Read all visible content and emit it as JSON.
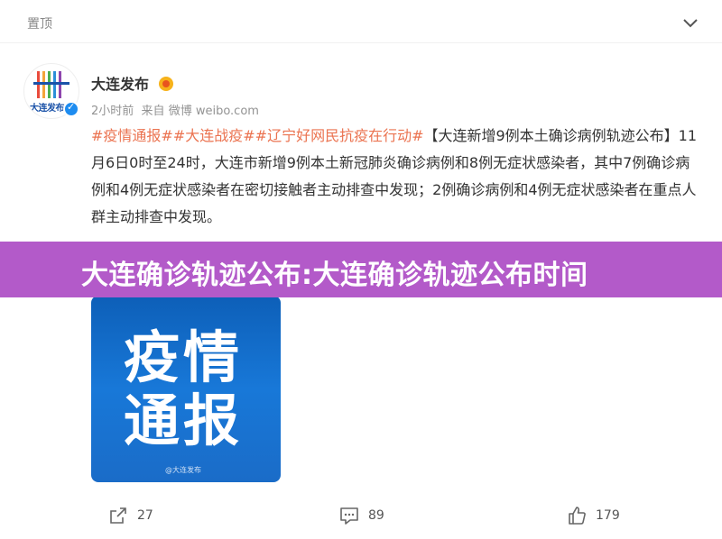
{
  "header": {
    "pinned_label": "置顶"
  },
  "account": {
    "name": "大连发布",
    "avatar_text": "大连发布",
    "time": "2小时前",
    "source_prefix": "来自",
    "source": "微博 weibo.com"
  },
  "post": {
    "hashtags": [
      "#疫情通报#",
      "#大连战疫#",
      "#辽宁好网民抗疫在行动#"
    ],
    "body": "【大连新增9例本土确诊病例轨迹公布】11月6日0时至24时，大连市新增9例本土新冠肺炎确诊病例和8例无症状感染者，其中7例确诊病例和4例无症状感染者在密切接触者主动排查中发现；2例确诊病例和4例无症状感染者在重点人群主动排查中发现。"
  },
  "overlay": {
    "title": "大连确诊轨迹公布:大连确诊轨迹公布时间"
  },
  "image": {
    "line1": "疫情",
    "line2": "通报",
    "watermark": "@大连发布"
  },
  "actions": {
    "repost_count": "27",
    "comment_count": "89",
    "like_count": "179"
  },
  "colors": {
    "hashtag": "#eb7350",
    "banner": "#b35ac9",
    "verified": "#1d8cf0",
    "image_bg": "#1878d8"
  },
  "icons": [
    "chevron-down-icon",
    "verified-icon",
    "vip-badge-icon",
    "repost-icon",
    "comment-icon",
    "like-icon"
  ]
}
